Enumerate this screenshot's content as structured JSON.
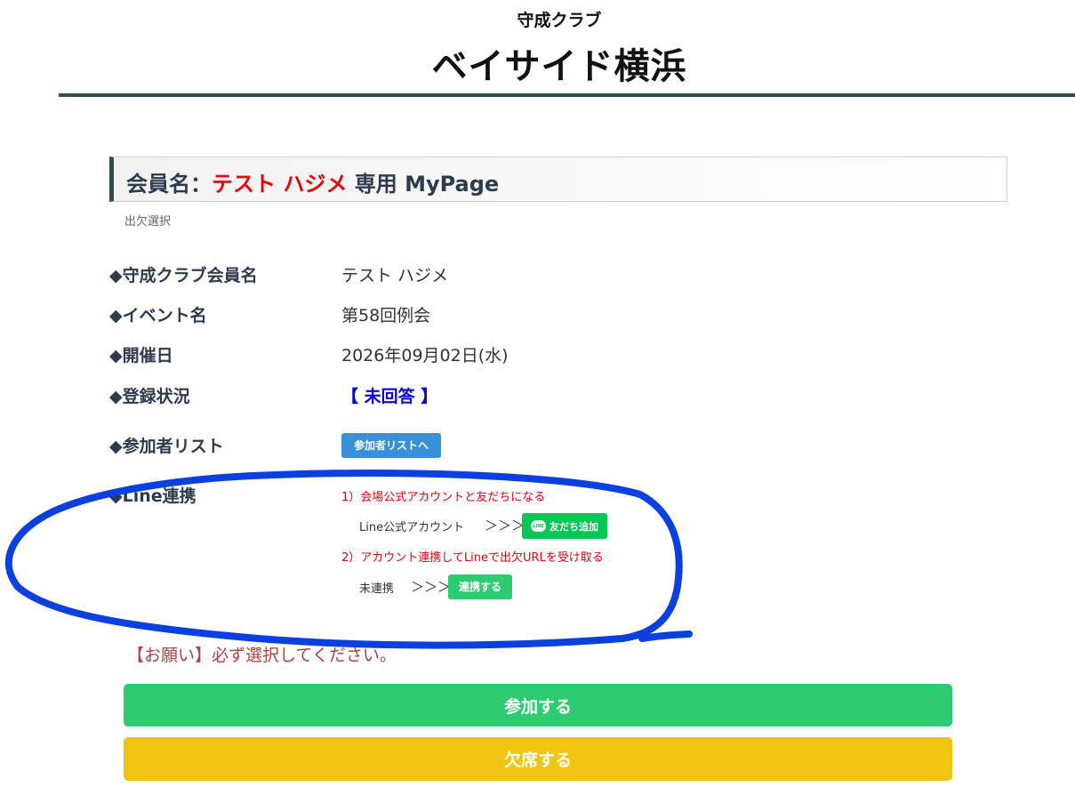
{
  "header": {
    "subtitle": "守成クラブ",
    "title": "ベイサイド横浜"
  },
  "member": {
    "prefix": "会員名：",
    "name": "テスト ハジメ",
    "suffix": " 専用 MyPage",
    "section_label": "出欠選択"
  },
  "details": [
    {
      "label": "◆守成クラブ会員名",
      "value": "テスト ハジメ"
    },
    {
      "label": "◆イベント名",
      "value": "第58回例会"
    },
    {
      "label": "◆開催日",
      "value": "2026年09月02日(水)"
    },
    {
      "label": "◆登録状況",
      "value": "【 未回答 】"
    }
  ],
  "participants": {
    "label": "◆参加者リスト",
    "button": "参加者リストへ"
  },
  "line": {
    "label": "◆Line連携",
    "step1": "1）会場公式アカウントと友だちになる",
    "account_label": "Line公式アカウント",
    "arrows": "＞＞＞",
    "friend_button": "友だち追加",
    "logo_text": "LINE",
    "step2": "2）アカウント連携してLineで出欠URLを受け取る",
    "link_status": "未連携",
    "link_button": "連携する"
  },
  "notice": "【お願い】必ず選択してください。",
  "actions": {
    "attend": "参加する",
    "absent": "欠席する"
  },
  "colors": {
    "accent_dark": "#2f4f4f",
    "member_name": "#e8000b",
    "status": "#0000dd",
    "attend": "#2ecc71",
    "absent": "#f1c40f",
    "line_green": "#06c755",
    "annotation": "#0a3fe0"
  }
}
